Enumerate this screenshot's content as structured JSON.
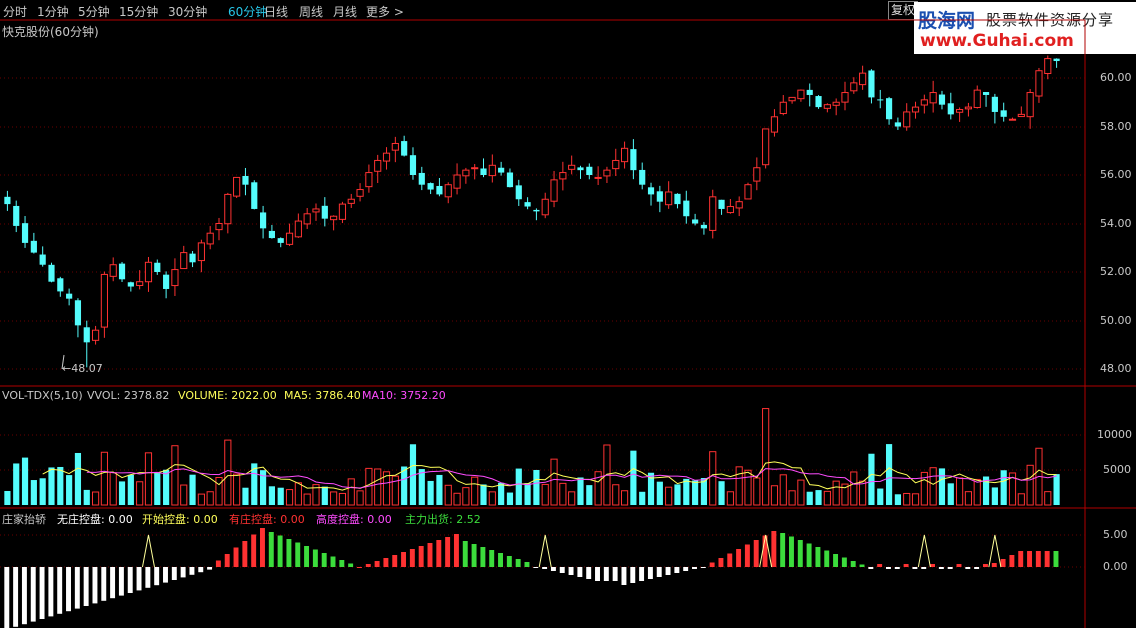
{
  "toolbar": {
    "tabs": [
      "分时",
      "1分钟",
      "5分钟",
      "15分钟",
      "30分钟",
      "60分钟",
      "日线",
      "周线",
      "月线",
      "更多 >"
    ],
    "active_index": 5,
    "restore_label": "复权"
  },
  "logo": {
    "brand": "股海网",
    "slogan": "股票软件资源分享",
    "url": "www.Guhai.com"
  },
  "stock_title": "快克股份(60分钟)",
  "price_panel": {
    "y_ticks": [
      "60.00",
      "58.00",
      "56.00",
      "54.00",
      "52.00",
      "50.00",
      "48.00"
    ],
    "low_marker": "48.07"
  },
  "volume_panel": {
    "indicator": "VOL-TDX(5,10)",
    "vvol_label": "VVOL: 2378.82",
    "volume_label": "VOLUME: 2022.00",
    "ma5_label": "MA5: 3786.40",
    "ma10_label": "MA10: 3752.20",
    "y_ticks": [
      "10000",
      "5000"
    ]
  },
  "indicator_panel": {
    "name": "庄家抬轿",
    "wz_label": "无庄控盘: 0.00",
    "ks_label": "开始控盘: 0.00",
    "yz_label": "有庄控盘: 0.00",
    "gd_label": "高度控盘: 0.00",
    "zl_label": "主力出货: 2.52",
    "y_ticks": [
      "5.00",
      "0.00"
    ]
  },
  "colors": {
    "up": "#ff3232",
    "down": "#54fcfc",
    "border": "#b00000",
    "grid": "#6a0000",
    "ma5": "#ffff5a",
    "ma10": "#ff4cff",
    "green": "#3cdc3c",
    "white": "#ffffff",
    "active_tab": "#27c6e8"
  },
  "chart_data": {
    "type": "candlestick",
    "closes": [
      54.8,
      53.9,
      53.2,
      52.8,
      52.3,
      51.6,
      51.2,
      50.9,
      49.8,
      49.1,
      49.6,
      51.9,
      52.3,
      51.7,
      51.4,
      51.6,
      52.4,
      52.0,
      51.3,
      52.1,
      52.8,
      52.4,
      53.2,
      53.6,
      54.0,
      55.2,
      55.9,
      55.6,
      54.6,
      53.8,
      53.4,
      53.2,
      53.6,
      54.1,
      54.4,
      54.6,
      54.2,
      54.3,
      54.8,
      55.0,
      55.4,
      56.1,
      56.6,
      56.9,
      57.3,
      56.8,
      56.0,
      55.6,
      55.4,
      55.2,
      55.6,
      56.0,
      56.2,
      56.3,
      56.0,
      56.4,
      56.1,
      55.5,
      55.0,
      54.7,
      54.5,
      55.0,
      55.8,
      56.1,
      56.4,
      56.2,
      56.0,
      55.9,
      56.2,
      56.6,
      57.1,
      56.2,
      55.6,
      55.2,
      54.9,
      55.3,
      54.8,
      54.3,
      54.0,
      53.8,
      55.1,
      54.6,
      54.7,
      54.9,
      55.6,
      56.3,
      57.9,
      58.4,
      59.0,
      59.2,
      59.5,
      59.3,
      58.8,
      58.9,
      59.0,
      59.4,
      59.8,
      60.2,
      59.2,
      59.1,
      58.3,
      58.0,
      58.6,
      58.8,
      59.1,
      59.4,
      58.9,
      58.5,
      58.7,
      58.8,
      59.5,
      59.3,
      58.6,
      58.4,
      58.3,
      58.5,
      59.4,
      60.3,
      60.8,
      60.7
    ]
  }
}
